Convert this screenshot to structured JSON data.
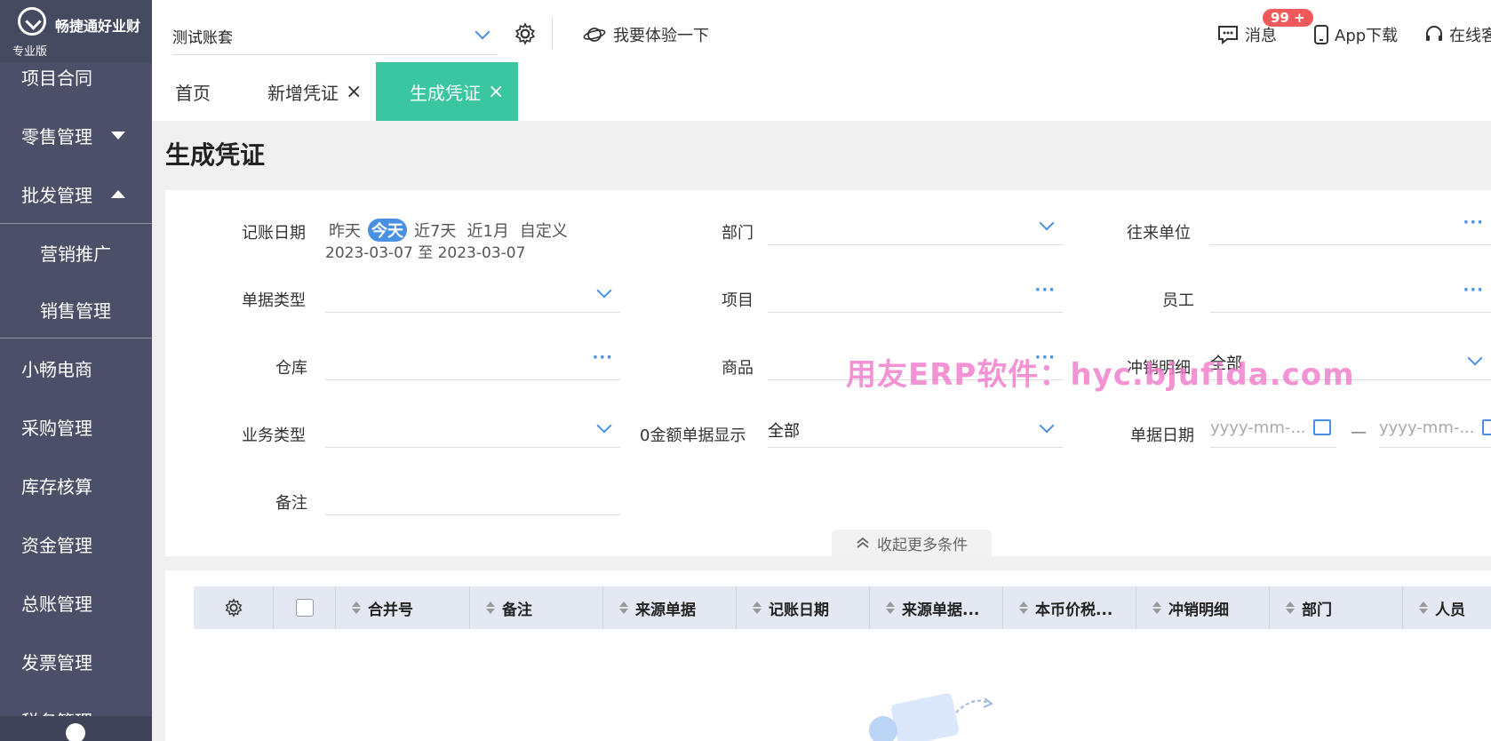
{
  "brand": {
    "name": "畅捷通好业财",
    "edition": "专业版"
  },
  "sidebar": {
    "items": [
      {
        "label": "项目合同"
      },
      {
        "label": "零售管理"
      },
      {
        "label": "批发管理"
      },
      {
        "label": "营销推广"
      },
      {
        "label": "销售管理"
      },
      {
        "label": "小畅电商"
      },
      {
        "label": "采购管理"
      },
      {
        "label": "库存核算"
      },
      {
        "label": "资金管理"
      },
      {
        "label": "总账管理"
      },
      {
        "label": "发票管理"
      },
      {
        "label": "税务管理"
      }
    ]
  },
  "topbar": {
    "account": "测试账套",
    "try_label": "我要体验一下",
    "messages_label": "消息",
    "messages_badge": "99 +",
    "app_label": "App下载",
    "online_label": "在线客"
  },
  "tabs": [
    {
      "label": "首页"
    },
    {
      "label": "新增凭证"
    },
    {
      "label": "生成凭证"
    }
  ],
  "page": {
    "title": "生成凭证"
  },
  "filters": {
    "date_label": "记账日期",
    "date_chips": [
      "昨天",
      "今天",
      "近7天",
      "近1月",
      "自定义"
    ],
    "date_range": "2023-03-07 至 2023-03-07",
    "dept_label": "部门",
    "partner_label": "往来单位",
    "doc_type_label": "单据类型",
    "project_label": "项目",
    "employee_label": "员工",
    "warehouse_label": "仓库",
    "product_label": "商品",
    "offset_label": "冲销明细",
    "offset_value": "全部",
    "biz_type_label": "业务类型",
    "zero_amount_label": "0金额单据显示",
    "zero_amount_value": "全部",
    "doc_date_label": "单据日期",
    "doc_date_start_placeholder": "yyyy-mm-...",
    "doc_date_end_placeholder": "yyyy-mm-...",
    "doc_date_sep": "—",
    "remark_label": "备注",
    "collapse_label": "收起更多条件"
  },
  "watermark": "用友ERP软件：hyc.bjufida.com",
  "table": {
    "columns": [
      "合并号",
      "备注",
      "来源单据",
      "记账日期",
      "来源单据...",
      "本币价税...",
      "冲销明细",
      "部门",
      "人员"
    ]
  }
}
